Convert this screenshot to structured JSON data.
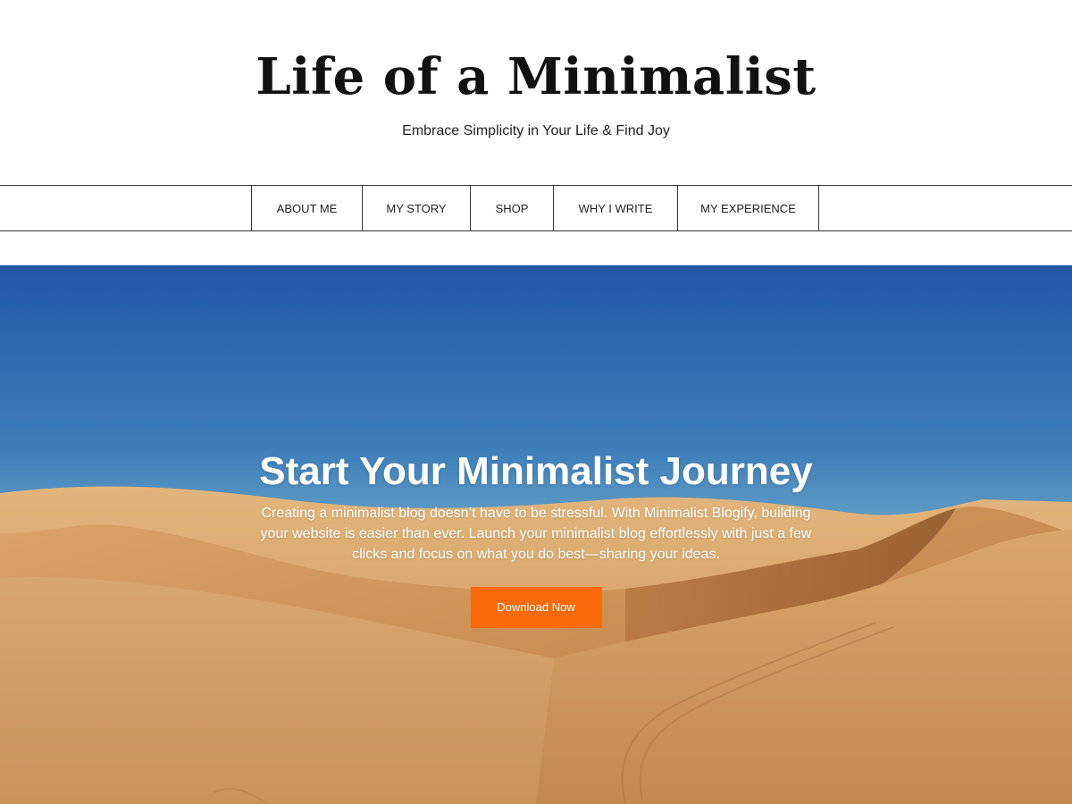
{
  "site": {
    "title": "Life of a Minimalist",
    "tagline": "Embrace Simplicity in Your Life & Find Joy"
  },
  "nav": {
    "items": [
      {
        "label": "ABOUT ME"
      },
      {
        "label": "MY STORY"
      },
      {
        "label": "SHOP"
      },
      {
        "label": "WHY I WRITE"
      },
      {
        "label": "MY EXPERIENCE"
      }
    ]
  },
  "hero": {
    "image": "desert-sand-dunes-under-blue-sky",
    "heading": "Start Your Minimalist Journey",
    "text": "Creating a minimalist blog doesn’t have to be stressful. With Minimalist Blogify, building your website is easier than ever. Launch your minimalist blog effortlessly with just a few clicks and focus on what you do best—sharing your ideas.",
    "button_label": "Download Now"
  },
  "colors": {
    "accent": "#fa6a0a",
    "text": "#111111",
    "border": "#333333",
    "sky": "#2558a6",
    "sand": "#d8a868"
  }
}
